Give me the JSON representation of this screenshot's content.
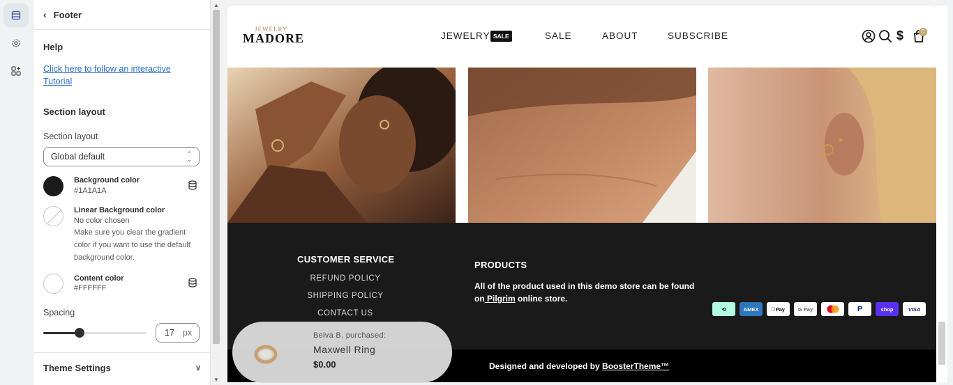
{
  "rail": {
    "items": [
      {
        "icon": "sections-icon",
        "active": true
      },
      {
        "icon": "gear-icon",
        "active": false
      },
      {
        "icon": "apps-icon",
        "active": false
      }
    ]
  },
  "panel": {
    "back_label": "Footer",
    "help": {
      "title": "Help",
      "link_text": "Click here to follow an interactive Tutorial"
    },
    "section_layout": {
      "title": "Section layout",
      "field_label": "Section layout",
      "selected": "Global default"
    },
    "colors": [
      {
        "title": "Background color",
        "value": "#1A1A1A",
        "swatch": "#1a1a1a"
      },
      {
        "title": "Linear Background color",
        "value": "No color chosen",
        "note": "Make sure you clear the gradient color if you want to use the default background color."
      },
      {
        "title": "Content color",
        "value": "#FFFFFF",
        "swatch": "#ffffff"
      }
    ],
    "spacing": {
      "label": "Spacing",
      "value": "17",
      "unit": "px",
      "level": 0.35
    },
    "theme_settings": "Theme Settings"
  },
  "store": {
    "logo_small": "JEWELRY",
    "logo_big": "MADORE",
    "nav": [
      {
        "label": "JEWELRY",
        "badge": "SALE"
      },
      {
        "label": "SALE"
      },
      {
        "label": "ABOUT"
      },
      {
        "label": "SUBSCRIBE"
      }
    ],
    "cart_count": "0"
  },
  "footer": {
    "customer_service": {
      "title": "CUSTOMER SERVICE",
      "links": [
        "REFUND POLICY",
        "SHIPPING POLICY",
        "CONTACT US"
      ]
    },
    "products": {
      "title": "PRODUCTS",
      "text_before": "All of the product used in this demo store can be found on",
      "link": " Pilgrim",
      "text_after": " online store."
    },
    "payments": [
      "Afterpay",
      "AMEX",
      "Apple Pay",
      "G Pay",
      "Mastercard",
      "PayPal",
      "shop",
      "VISA"
    ],
    "credit_prefix": "Designed and developed by ",
    "credit_link": "BoosterTheme™"
  },
  "popup": {
    "who": "Belva B. purchased:",
    "item": "Maxwell Ring",
    "price": "$0.00"
  }
}
